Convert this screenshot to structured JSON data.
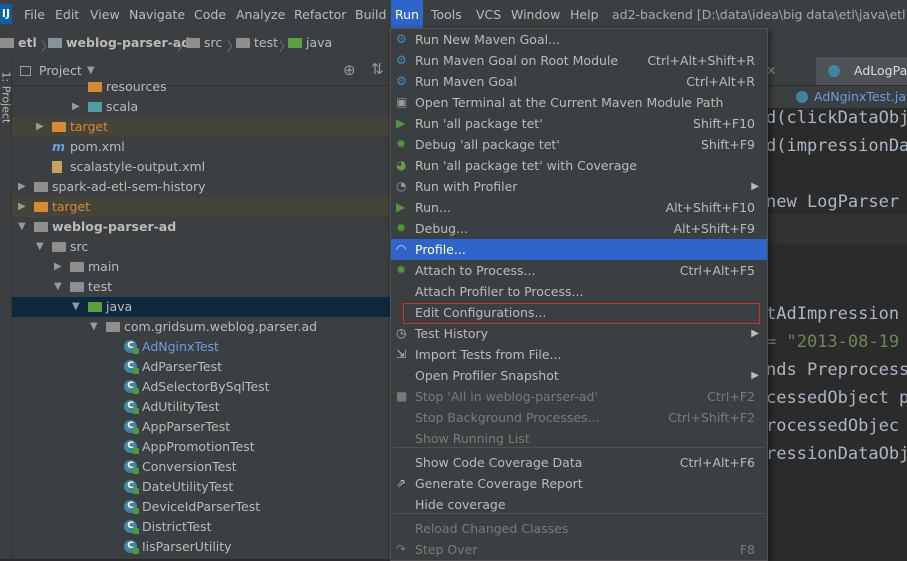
{
  "menubar": {
    "items": [
      "File",
      "Edit",
      "View",
      "Navigate",
      "Code",
      "Analyze",
      "Refactor",
      "Build",
      "Run",
      "Tools",
      "VCS",
      "Window",
      "Help"
    ],
    "window_title": "ad2-backend [D:\\data\\idea\\big data\\etl\\java\\etl] -"
  },
  "breadcrumb": [
    "etl",
    "weblog-parser-ad",
    "src",
    "test",
    "java"
  ],
  "left_strip": {
    "label": "1: Project"
  },
  "project_panel": {
    "title": "Project",
    "rows": [
      {
        "label": "resources",
        "indent": 4,
        "arrow": "",
        "icon": "resources"
      },
      {
        "label": "scala",
        "indent": 4,
        "arrow": "right",
        "icon": "folder-teal"
      },
      {
        "label": "target",
        "indent": 2,
        "arrow": "right",
        "icon": "folder-orange",
        "style": "orange",
        "hl": true
      },
      {
        "label": "pom.xml",
        "indent": 2,
        "arrow": "",
        "icon": "maven"
      },
      {
        "label": "scalastyle-output.xml",
        "indent": 2,
        "arrow": "",
        "icon": "xml"
      },
      {
        "label": "spark-ad-etl-sem-history",
        "indent": 1,
        "arrow": "right",
        "icon": "folder"
      },
      {
        "label": "target",
        "indent": 1,
        "arrow": "right",
        "icon": "folder-orange",
        "style": "orange",
        "hl": true
      },
      {
        "label": "weblog-parser-ad",
        "indent": 1,
        "arrow": "down",
        "icon": "folder",
        "style": "bold"
      },
      {
        "label": "src",
        "indent": 2,
        "arrow": "down",
        "icon": "folder"
      },
      {
        "label": "main",
        "indent": 3,
        "arrow": "right",
        "icon": "folder"
      },
      {
        "label": "test",
        "indent": 3,
        "arrow": "down",
        "icon": "folder"
      },
      {
        "label": "java",
        "indent": 4,
        "arrow": "down",
        "icon": "folder-green",
        "sel": true
      },
      {
        "label": "com.gridsum.weblog.parser.ad",
        "indent": 5,
        "arrow": "down",
        "icon": "package"
      },
      {
        "label": "AdNginxTest",
        "indent": 6,
        "arrow": "",
        "icon": "test",
        "style": "blue"
      },
      {
        "label": "AdParserTest",
        "indent": 6,
        "arrow": "",
        "icon": "test"
      },
      {
        "label": "AdSelectorBySqlTest",
        "indent": 6,
        "arrow": "",
        "icon": "test"
      },
      {
        "label": "AdUtilityTest",
        "indent": 6,
        "arrow": "",
        "icon": "test"
      },
      {
        "label": "AppParserTest",
        "indent": 6,
        "arrow": "",
        "icon": "test"
      },
      {
        "label": "AppPromotionTest",
        "indent": 6,
        "arrow": "",
        "icon": "test"
      },
      {
        "label": "ConversionTest",
        "indent": 6,
        "arrow": "",
        "icon": "test"
      },
      {
        "label": "DateUtilityTest",
        "indent": 6,
        "arrow": "",
        "icon": "test"
      },
      {
        "label": "DeviceIdParserTest",
        "indent": 6,
        "arrow": "",
        "icon": "test"
      },
      {
        "label": "DistrictTest",
        "indent": 6,
        "arrow": "",
        "icon": "test"
      },
      {
        "label": "IisParserUtility",
        "indent": 6,
        "arrow": "",
        "icon": "test"
      }
    ]
  },
  "editor": {
    "tabs": [
      "AdLogPa"
    ],
    "file_tab": "AdNginxTest.java",
    "code_lines": [
      {
        "text": "d(clickDataObj",
        "kind": "code"
      },
      {
        "text": "d(impressionDa",
        "kind": "code"
      },
      {
        "text": " new LogParser",
        "kind": "code"
      },
      {
        "text": "tAdImpression",
        "kind": "code"
      },
      {
        "text": "= \"2013-08-19",
        "kind": "str"
      },
      {
        "text": "nds Preprocess",
        "kind": "code"
      },
      {
        "text": "cessedObject p",
        "kind": "code"
      },
      {
        "text": "rocessedObjec",
        "kind": "code"
      },
      {
        "text": "ressionDataObj",
        "kind": "code"
      }
    ]
  },
  "run_menu": {
    "items": [
      {
        "label": "Run New Maven Goal...",
        "shortcut": "",
        "icon": "maven-gear"
      },
      {
        "label": "Run Maven Goal on Root Module",
        "shortcut": "Ctrl+Alt+Shift+R",
        "icon": "maven-gear"
      },
      {
        "label": "Run Maven Goal",
        "shortcut": "Ctrl+Alt+R",
        "icon": "maven-gear"
      },
      {
        "label": "Open Terminal at the Current Maven Module Path",
        "shortcut": "",
        "icon": "terminal"
      },
      {
        "label": "Run 'all package tet'",
        "shortcut": "Shift+F10",
        "icon": "run"
      },
      {
        "label": "Debug 'all package tet'",
        "shortcut": "Shift+F9",
        "icon": "debug"
      },
      {
        "label": "Run 'all package tet' with Coverage",
        "shortcut": "",
        "icon": "coverage"
      },
      {
        "label": "Run with Profiler",
        "shortcut": "",
        "icon": "profiler",
        "submenu": true
      },
      {
        "label": "Run...",
        "shortcut": "Alt+Shift+F10",
        "icon": "run"
      },
      {
        "label": "Debug...",
        "shortcut": "Alt+Shift+F9",
        "icon": "debug"
      },
      {
        "label": "Profile...",
        "shortcut": "",
        "icon": "profile",
        "selected": true
      },
      {
        "label": "Attach to Process...",
        "shortcut": "Ctrl+Alt+F5",
        "icon": "attach"
      },
      {
        "label": "Attach Profiler to Process...",
        "shortcut": "",
        "icon": ""
      },
      {
        "label": "Edit Configurations...",
        "shortcut": "",
        "icon": ""
      },
      {
        "label": "Test History",
        "shortcut": "",
        "icon": "history",
        "submenu": true
      },
      {
        "label": "Import Tests from File...",
        "shortcut": "",
        "icon": "import"
      },
      {
        "label": "Open Profiler Snapshot",
        "shortcut": "",
        "icon": "",
        "submenu": true
      },
      {
        "label": "Stop 'All in weblog-parser-ad'",
        "shortcut": "Ctrl+F2",
        "icon": "stop",
        "disabled": true
      },
      {
        "label": "Stop Background Processes...",
        "shortcut": "Ctrl+Shift+F2",
        "icon": "",
        "disabled": true
      },
      {
        "label": "Show Running List",
        "shortcut": "",
        "icon": "",
        "disabled": true
      },
      {
        "label": "Show Code Coverage Data",
        "shortcut": "Ctrl+Alt+F6",
        "icon": ""
      },
      {
        "label": "Generate Coverage Report",
        "shortcut": "",
        "icon": "report"
      },
      {
        "label": "Hide coverage",
        "shortcut": "",
        "icon": ""
      },
      {
        "label": "Reload Changed Classes",
        "shortcut": "",
        "icon": "",
        "disabled": true
      },
      {
        "label": "Step Over",
        "shortcut": "F8",
        "icon": "step",
        "disabled": true
      }
    ]
  },
  "colors": {
    "accent": "#2f65ca",
    "focus_border": "#d32f2f",
    "background": "#2b2b2b",
    "panel": "#3c3f41"
  }
}
